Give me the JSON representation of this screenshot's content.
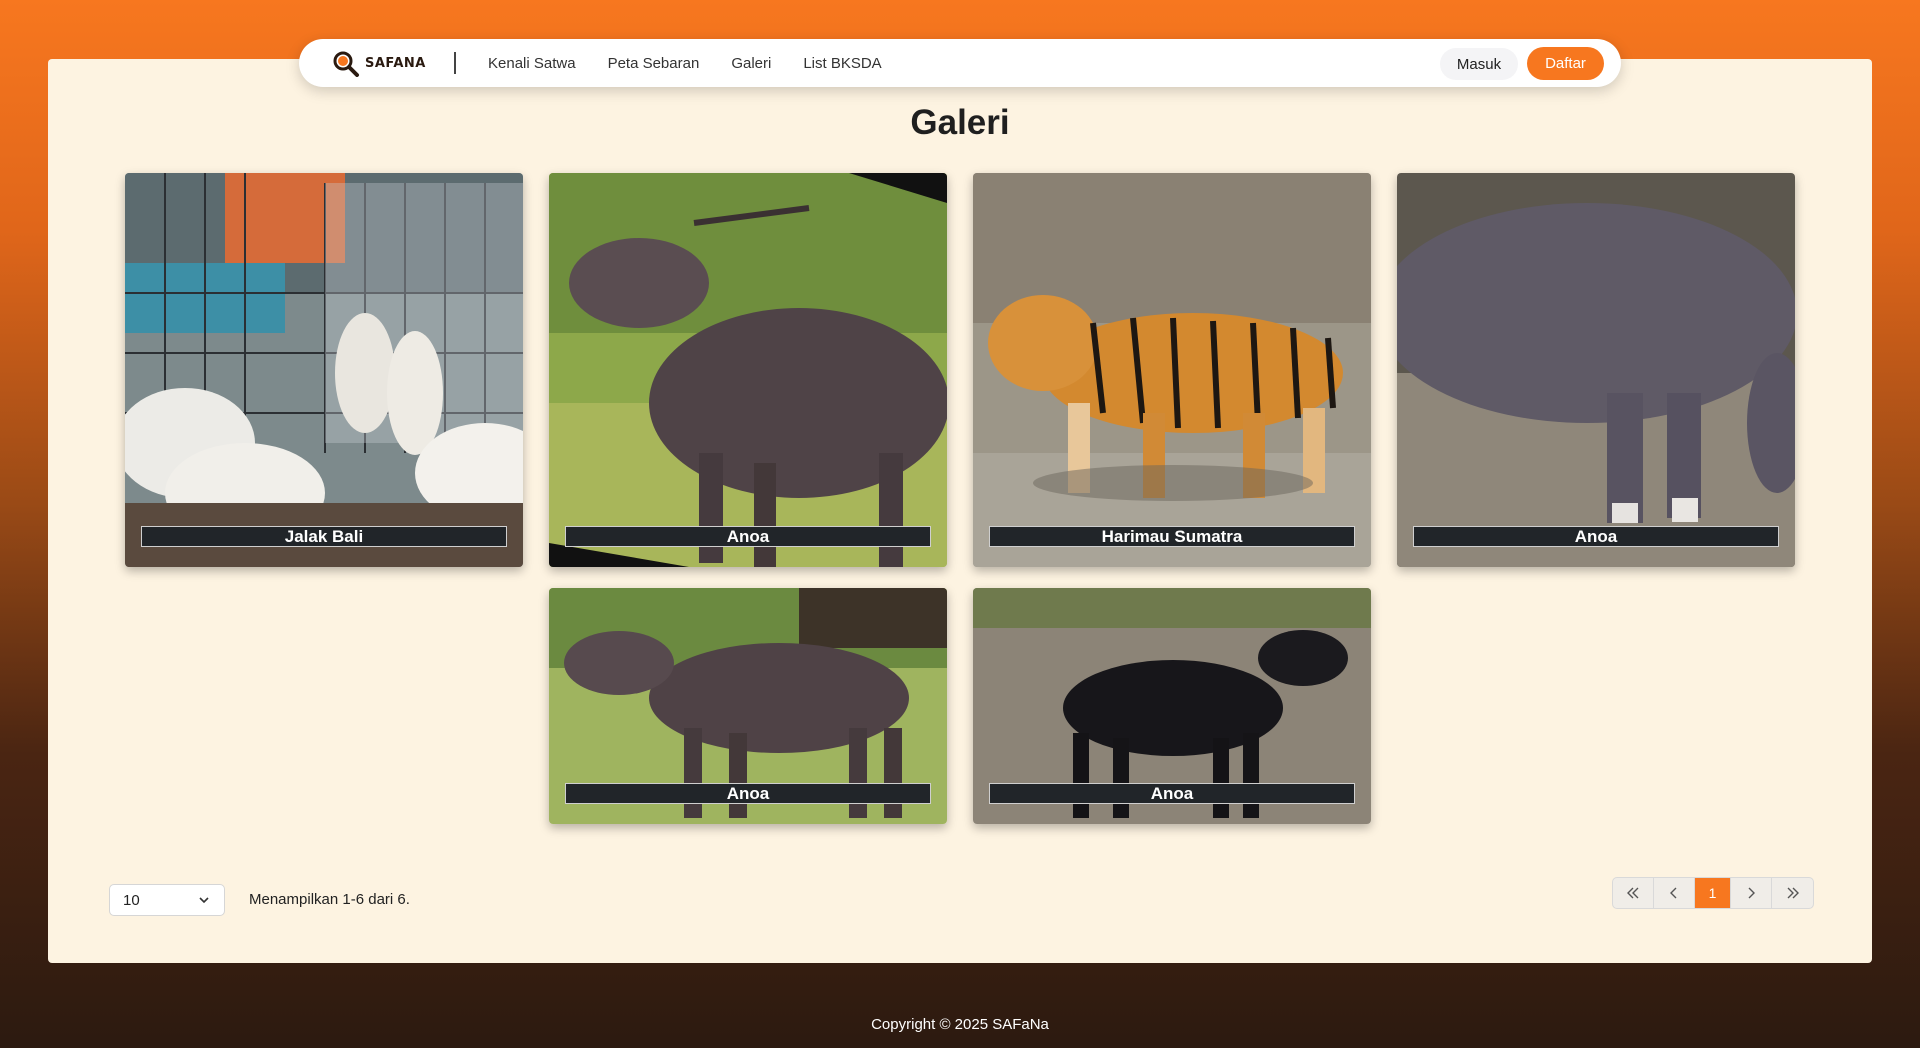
{
  "brand": {
    "name": "SAFANA"
  },
  "nav": {
    "links": [
      "Kenali Satwa",
      "Peta Sebaran",
      "Galeri",
      "List BKSDA"
    ],
    "login_label": "Masuk",
    "register_label": "Daftar"
  },
  "page": {
    "title": "Galeri"
  },
  "gallery": {
    "items": [
      {
        "caption": "Jalak Bali"
      },
      {
        "caption": "Anoa"
      },
      {
        "caption": "Harimau Sumatra"
      },
      {
        "caption": "Anoa"
      },
      {
        "caption": "Anoa"
      },
      {
        "caption": "Anoa"
      }
    ]
  },
  "pagination": {
    "per_page": "10",
    "summary": "Menampilkan 1-6 dari 6.",
    "current_page": "1"
  },
  "footer": {
    "copyright": "Copyright © 2025 SAFaNa"
  },
  "colors": {
    "accent": "#f7771f",
    "panel": "#fdf3e1",
    "caption_bg": "#212529"
  }
}
